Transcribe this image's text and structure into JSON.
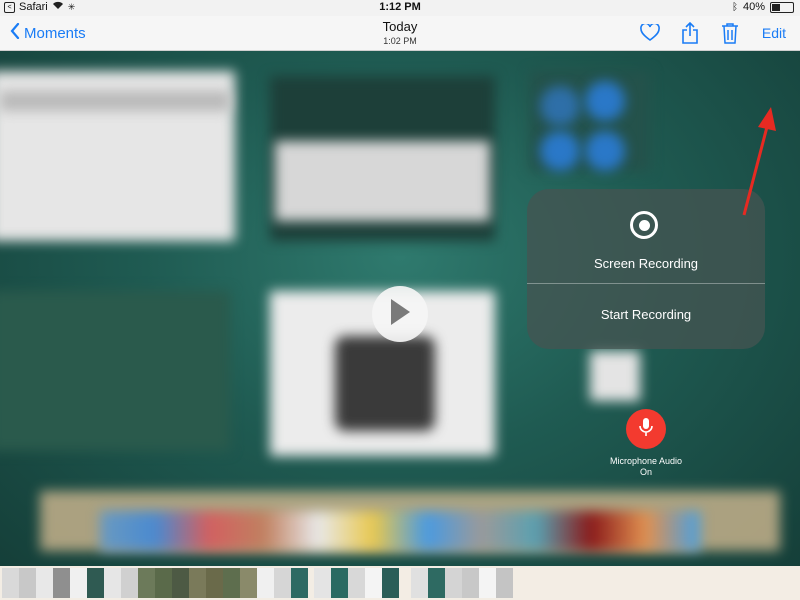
{
  "status_bar": {
    "back_app": "Safari",
    "time": "1:12 PM",
    "battery_percent": "40%",
    "battery_level": 0.4
  },
  "nav": {
    "back_label": "Moments",
    "title": "Today",
    "subtitle": "1:02 PM",
    "edit_label": "Edit",
    "icons": [
      "heart-icon",
      "share-icon",
      "trash-icon"
    ]
  },
  "control_center": {
    "title": "Screen Recording",
    "action": "Start Recording",
    "mic_label": "Microphone Audio",
    "mic_state": "On"
  },
  "colors": {
    "accent": "#1a7cf5",
    "mic": "#f33a2f",
    "annotation_arrow": "#e62a22"
  },
  "thumbnails": {
    "colors": [
      "#d9d9d9",
      "#c8c8c8",
      "#e8e8e8",
      "#8f8f8f",
      "#f0f0f0",
      "#2f5a52",
      "#e6e6e6",
      "#d0d0d0",
      "#6c7a5a",
      "#5a6a4a",
      "#4d5a44",
      "#7a7a5a",
      "#6a6a4a",
      "#5e6e4e",
      "#8a8a6a",
      "#f0f0f0",
      "#d6d6d6",
      "#2d6a63",
      "#e4e4e4",
      "#2a6a62",
      "#d8d8d8",
      "#f4f4f4",
      "#2a5e58",
      "#e0e0e0",
      "#2e6a62",
      "#d4d4d4",
      "#c8c8c8",
      "#f4f4f4",
      "#c4c4c4"
    ]
  }
}
